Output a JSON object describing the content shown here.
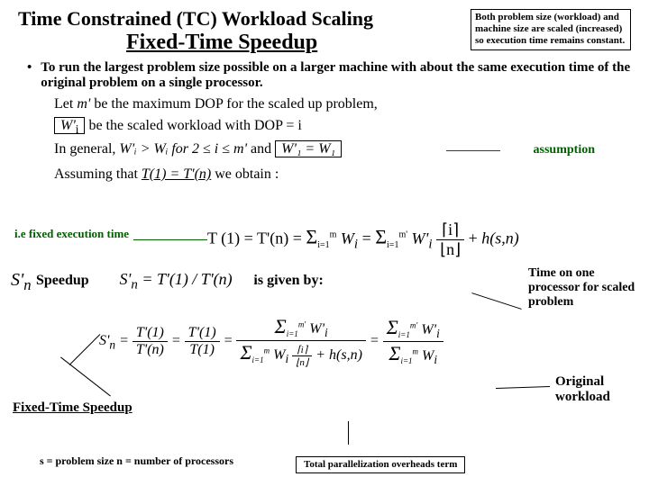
{
  "header": {
    "title1": "Time Constrained (TC) Workload Scaling",
    "title2": "Fixed-Time Speedup",
    "callout": "Both problem size (workload) and machine size are scaled (increased) so execution time remains constant."
  },
  "bullet": "To run the largest problem size possible on a larger machine with about the same execution time of the original problem on a single processor.",
  "math": {
    "line1_a": "Let ",
    "line1_b": "m'",
    "line1_c": " be the maximum DOP for the scaled up problem,",
    "line2_a": "W'",
    "line2_b": " be the scaled workload with DOP = i",
    "line3_a": "In general, ",
    "line3_b": "W'ᵢ > Wᵢ  for  2 ≤ i ≤ m'",
    "line3_c": "  and  ",
    "line3_d": "W'₁ = W₁",
    "line4_a": "Assuming that ",
    "line4_b": "T(1) = T'(n)",
    "line4_c": " we obtain :"
  },
  "labels": {
    "assumption": "assumption",
    "ie_fixed": "i.e fixed execution time",
    "speedup": "Speedup",
    "is_given_by": "is given by:",
    "time_on_one": "Time on one processor for scaled problem",
    "fixed_time_speedup": "Fixed-Time Speedup",
    "original_workload": "Original workload",
    "overheads": "Total parallelization overheads term",
    "footer": "s = problem size   n = number of processors"
  },
  "equations": {
    "sprime_n": "S'ₙ",
    "t1_eq": "T (1) = T'(n) = Σ Wᵢ = Σ W'ᵢ ⌈i/n⌉ + h(s,n)",
    "speedup_def": "S'ₙ = T'(1) / T'(n)",
    "big_num": "Σ W'ᵢ",
    "big_den": "Σ Wᵢ ⌈i/n⌉ + h(s,n)",
    "rhs_num": "Σ W'ᵢ",
    "rhs_den": "Σ Wᵢ",
    "tprime1": "T'(1)",
    "tprime_n": "T'(n)",
    "t1": "T(1)"
  }
}
